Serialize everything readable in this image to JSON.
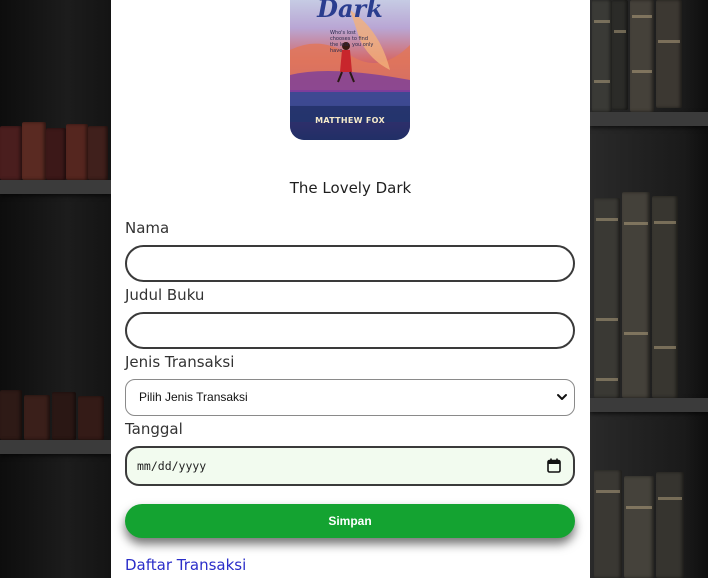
{
  "book": {
    "cover_title": "Dark",
    "cover_tagline": "Who's lost chooses to find the lost, you only have",
    "cover_author": "MATTHEW FOX",
    "title": "The Lovely Dark"
  },
  "form": {
    "name_label": "Nama",
    "name_value": "",
    "book_label": "Judul Buku",
    "book_value": "",
    "type_label": "Jenis Transaksi",
    "type_selected": "Pilih Jenis Transaksi",
    "date_label": "Tanggal",
    "date_placeholder": "mm/dd/yyyy",
    "submit_label": "Simpan"
  },
  "links": {
    "list_label": "Daftar Transaksi"
  },
  "colors": {
    "submit_bg": "#14a331",
    "link": "#2b2ec9",
    "date_bg": "#f2fbef"
  },
  "icons": {
    "select": "chevron-down-icon",
    "date": "calendar-icon"
  }
}
